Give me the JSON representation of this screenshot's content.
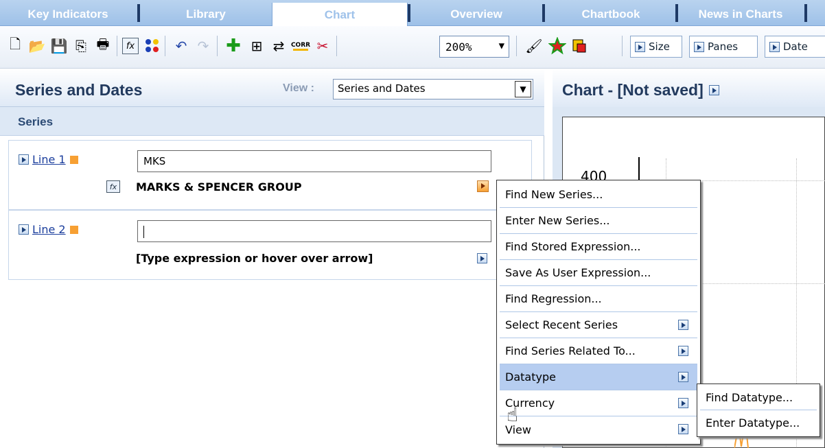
{
  "tabs": [
    {
      "label": "Key Indicators"
    },
    {
      "label": "Library"
    },
    {
      "label": "Chart",
      "active": true
    },
    {
      "label": "Overview"
    },
    {
      "label": "Chartbook"
    },
    {
      "label": "News in Charts"
    }
  ],
  "toolbar": {
    "zoom_value": "200%",
    "corr_label": "CORR",
    "size_label": "Size",
    "panes_label": "Panes",
    "dates_label": "Date"
  },
  "left_panel": {
    "title": "Series and Dates",
    "view_label": "View :",
    "view_value": "Series and Dates",
    "series_header": "Series",
    "lines": [
      {
        "label": "Line 1",
        "input_value": "MKS",
        "description": "MARKS & SPENCER GROUP"
      },
      {
        "label": "Line 2",
        "input_value": "",
        "description": "[Type expression or hover over arrow]"
      }
    ]
  },
  "right_panel": {
    "title": "Chart - [Not saved]",
    "y_tick": "400"
  },
  "menu": {
    "items": [
      {
        "label": "Find New Series..."
      },
      {
        "label": "Enter New Series..."
      },
      {
        "label": "Find Stored Expression..."
      },
      {
        "label": "Save As User Expression..."
      },
      {
        "label": "Find Regression..."
      },
      {
        "label": "Select Recent Series",
        "submenu": true
      },
      {
        "label": "Find Series Related To...",
        "submenu": true
      },
      {
        "label": "Datatype",
        "submenu": true,
        "highlighted": true
      },
      {
        "label": "Currency",
        "submenu": true
      },
      {
        "label": "View",
        "submenu": true
      }
    ],
    "submenu_items": [
      {
        "label": "Find Datatype..."
      },
      {
        "label": "Enter Datatype..."
      }
    ]
  },
  "colors": {
    "tab_bg": "#9ec1e8",
    "highlight": "#b6cdf0",
    "series_marker": "#f7a033",
    "link": "#1a3d9c"
  }
}
